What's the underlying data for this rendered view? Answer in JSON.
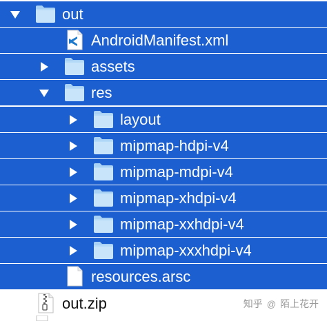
{
  "colors": {
    "selection": "#1b5fd1",
    "folder_fill": "#c7e4fb",
    "folder_tab": "#a9d1f3",
    "disclosure": "#ffffff",
    "plain_text": "#111111"
  },
  "tree": [
    {
      "label": "out",
      "icon": "folder-icon",
      "disclosure": "expanded",
      "selected": true
    },
    {
      "label": "AndroidManifest.xml",
      "icon": "vscode-file-icon",
      "disclosure": "none",
      "selected": true
    },
    {
      "label": "assets",
      "icon": "folder-icon",
      "disclosure": "collapsed",
      "selected": true
    },
    {
      "label": "res",
      "icon": "folder-icon",
      "disclosure": "expanded",
      "selected": true
    },
    {
      "label": "layout",
      "icon": "folder-icon",
      "disclosure": "collapsed",
      "selected": true
    },
    {
      "label": "mipmap-hdpi-v4",
      "icon": "folder-icon",
      "disclosure": "collapsed",
      "selected": true
    },
    {
      "label": "mipmap-mdpi-v4",
      "icon": "folder-icon",
      "disclosure": "collapsed",
      "selected": true
    },
    {
      "label": "mipmap-xhdpi-v4",
      "icon": "folder-icon",
      "disclosure": "collapsed",
      "selected": true
    },
    {
      "label": "mipmap-xxhdpi-v4",
      "icon": "folder-icon",
      "disclosure": "collapsed",
      "selected": true
    },
    {
      "label": "mipmap-xxxhdpi-v4",
      "icon": "folder-icon",
      "disclosure": "collapsed",
      "selected": true
    },
    {
      "label": "resources.arsc",
      "icon": "document-icon",
      "disclosure": "none",
      "selected": true
    },
    {
      "label": "out.zip",
      "icon": "zip-file-icon",
      "disclosure": "none",
      "selected": false
    }
  ],
  "watermark": {
    "site": "知乎",
    "separator": "@",
    "author": "陌上花开"
  }
}
